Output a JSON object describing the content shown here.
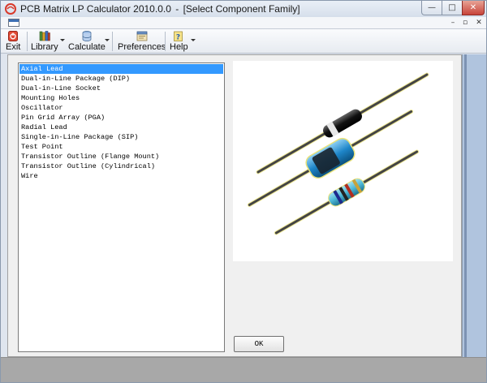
{
  "window": {
    "app_title": "PCB Matrix LP Calculator 2010.0.0",
    "separator": "-",
    "dialog_title": "[Select Component Family]",
    "minimize_glyph": "—",
    "maximize_glyph": "□",
    "close_glyph": "✕"
  },
  "mdi": {
    "minimize_glyph": "–",
    "maximize_glyph": "▫",
    "close_glyph": "✕"
  },
  "toolbar": {
    "items": [
      {
        "label": "Exit",
        "icon": "exit-icon",
        "has_dropdown": false
      },
      {
        "label": "Library",
        "icon": "books-icon",
        "has_dropdown": true
      },
      {
        "label": "Calculate",
        "icon": "database-icon",
        "has_dropdown": true
      },
      {
        "label": "Preferences",
        "icon": "preferences-icon",
        "has_dropdown": false
      },
      {
        "label": "Help",
        "icon": "help-icon",
        "has_dropdown": true
      }
    ]
  },
  "component_list": {
    "items": [
      "Axial Lead",
      "Dual-in-Line Package (DIP)",
      "Dual-in-Line Socket",
      "Mounting Holes",
      "Oscillator",
      "Pin Grid Array (PGA)",
      "Radial Lead",
      "Single-in-Line Package (SIP)",
      "Test Point",
      "Transistor Outline (Flange Mount)",
      "Transistor Outline (Cylindrical)",
      "Wire"
    ],
    "selected_index": 0
  },
  "preview": {
    "image": "axial-lead-components-illustration"
  },
  "ok_button": {
    "label": "OK"
  },
  "colors": {
    "selection": "#3399ff",
    "title_bar": "#dbe4ef",
    "close_button": "#c7443a"
  }
}
